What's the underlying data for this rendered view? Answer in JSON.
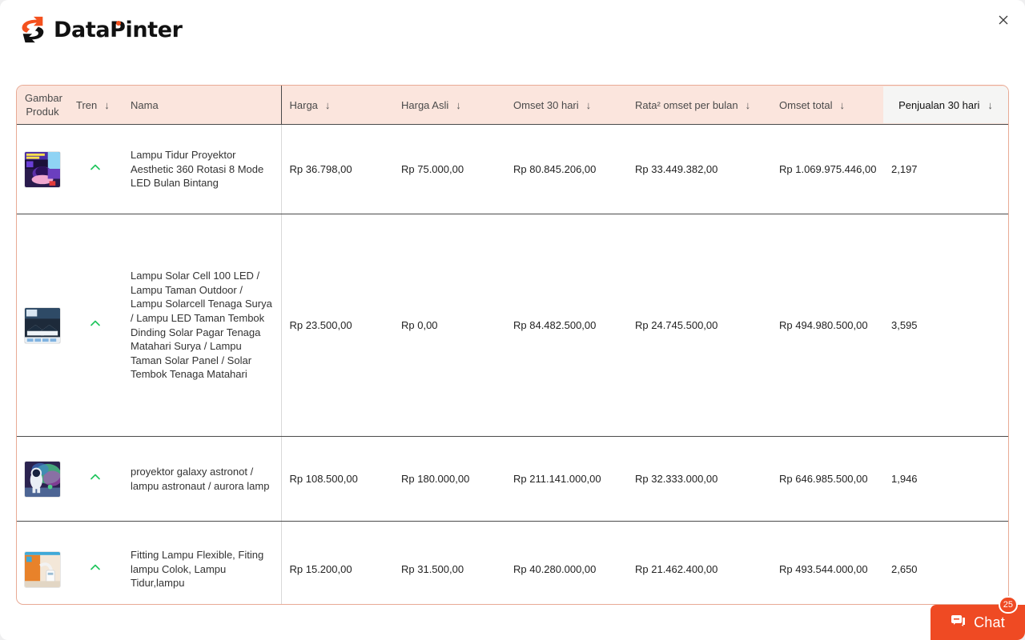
{
  "window": {
    "close_label": "✕"
  },
  "brand": {
    "name": "DataPinter",
    "mark": "s-arrow-logo",
    "accent_color": "#F4511E"
  },
  "table": {
    "sort_icon": "↓",
    "active_column": "Penjualan 30 hari",
    "columns": [
      {
        "id": "gambar_produk",
        "label_line1": "Gambar",
        "label_line2": "Produk",
        "sortable": false
      },
      {
        "id": "tren",
        "label": "Tren",
        "sortable": true
      },
      {
        "id": "nama",
        "label": "Nama",
        "sortable": false
      },
      {
        "id": "harga",
        "label": "Harga",
        "sortable": true
      },
      {
        "id": "harga_asli",
        "label": "Harga Asli",
        "sortable": true
      },
      {
        "id": "omset_30_hari",
        "label": "Omset 30 hari",
        "sortable": true
      },
      {
        "id": "rata_omset_per_bulan",
        "label": "Rata² omset per bulan",
        "sortable": true
      },
      {
        "id": "omset_total",
        "label": "Omset total",
        "sortable": true
      },
      {
        "id": "penjualan_30_hari",
        "label": "Penjualan 30 hari",
        "sortable": true
      }
    ],
    "rows": [
      {
        "image": "lampu-tidur-proyektor-thumbnail",
        "tren": "chevron-up-icon",
        "tren_direction": "up",
        "nama": "Lampu Tidur Proyektor Aesthetic 360 Rotasi 8 Mode LED Bulan Bintang",
        "harga": "Rp 36.798,00",
        "harga_asli": "Rp 75.000,00",
        "omset_30_hari": "Rp 80.845.206,00",
        "rata_omset_per_bulan": "Rp 33.449.382,00",
        "omset_total": "Rp 1.069.975.446,00",
        "penjualan_30_hari": "2,197"
      },
      {
        "image": "lampu-solar-cell-thumbnail",
        "tren": "chevron-up-icon",
        "tren_direction": "up",
        "nama": "Lampu Solar Cell 100 LED / Lampu Taman Outdoor / Lampu Solarcell Tenaga Surya / Lampu LED Taman Tembok Dinding Solar Pagar Tenaga Matahari Surya / Lampu Taman Solar Panel / Solar Tembok Tenaga Matahari",
        "harga": "Rp 23.500,00",
        "harga_asli": "Rp 0,00",
        "omset_30_hari": "Rp 84.482.500,00",
        "rata_omset_per_bulan": "Rp 24.745.500,00",
        "omset_total": "Rp 494.980.500,00",
        "penjualan_30_hari": "3,595"
      },
      {
        "image": "proyektor-galaxy-astronot-thumbnail",
        "tren": "chevron-up-icon",
        "tren_direction": "up",
        "nama": "proyektor galaxy astronot / lampu astronaut / aurora lamp",
        "harga": "Rp 108.500,00",
        "harga_asli": "Rp 180.000,00",
        "omset_30_hari": "Rp 211.141.000,00",
        "rata_omset_per_bulan": "Rp 32.333.000,00",
        "omset_total": "Rp 646.985.500,00",
        "penjualan_30_hari": "1,946"
      },
      {
        "image": "fitting-lampu-flexible-thumbnail",
        "tren": "chevron-up-icon",
        "tren_direction": "up",
        "nama": "Fitting Lampu Flexible, Fiting lampu Colok, Lampu Tidur,lampu",
        "harga": "Rp 15.200,00",
        "harga_asli": "Rp 31.500,00",
        "omset_30_hari": "Rp 40.280.000,00",
        "rata_omset_per_bulan": "Rp 21.462.400,00",
        "omset_total": "Rp 493.544.000,00",
        "penjualan_30_hari": "2,650"
      }
    ]
  },
  "chat": {
    "label": "Chat",
    "badge": "25",
    "icon": "chat-bubble-icon",
    "color": "#EF4A23"
  }
}
